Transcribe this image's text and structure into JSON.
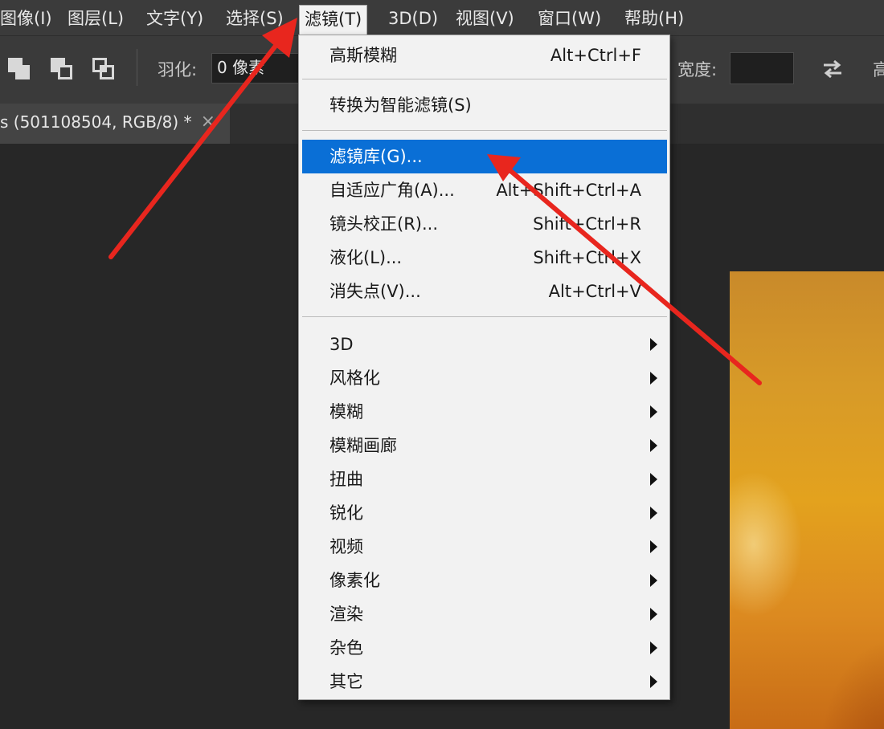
{
  "menubar": {
    "items": [
      {
        "label": "图像(I)"
      },
      {
        "label": "图层(L)"
      },
      {
        "label": "文字(Y)"
      },
      {
        "label": "选择(S)"
      },
      {
        "label": "滤镜(T)"
      },
      {
        "label": "3D(D)"
      },
      {
        "label": "视图(V)"
      },
      {
        "label": "窗口(W)"
      },
      {
        "label": "帮助(H)"
      }
    ]
  },
  "options": {
    "feather_label": "羽化:",
    "feather_value": "0 像素",
    "width_label": "宽度:",
    "width_value": "",
    "height_label_partial": "高"
  },
  "document_tab": {
    "title": "s (501108504, RGB/8) *",
    "close": "×"
  },
  "filter_menu": {
    "items": [
      {
        "label": "高斯模糊",
        "shortcut": "Alt+Ctrl+F"
      },
      {
        "label": "转换为智能滤镜(S)",
        "shortcut": ""
      },
      {
        "label": "滤镜库(G)...",
        "shortcut": "",
        "highlighted": true
      },
      {
        "label": "自适应广角(A)...",
        "shortcut": "Alt+Shift+Ctrl+A"
      },
      {
        "label": "镜头校正(R)...",
        "shortcut": "Shift+Ctrl+R"
      },
      {
        "label": "液化(L)...",
        "shortcut": "Shift+Ctrl+X"
      },
      {
        "label": "消失点(V)...",
        "shortcut": "Alt+Ctrl+V"
      }
    ],
    "submenus": [
      {
        "label": "3D"
      },
      {
        "label": "风格化"
      },
      {
        "label": "模糊"
      },
      {
        "label": "模糊画廊"
      },
      {
        "label": "扭曲"
      },
      {
        "label": "锐化"
      },
      {
        "label": "视频"
      },
      {
        "label": "像素化"
      },
      {
        "label": "渲染"
      },
      {
        "label": "杂色"
      },
      {
        "label": "其它"
      }
    ]
  },
  "colors": {
    "highlight": "#0a6fd6",
    "annotation_arrow": "#e8261e",
    "app_background": "#272727"
  }
}
